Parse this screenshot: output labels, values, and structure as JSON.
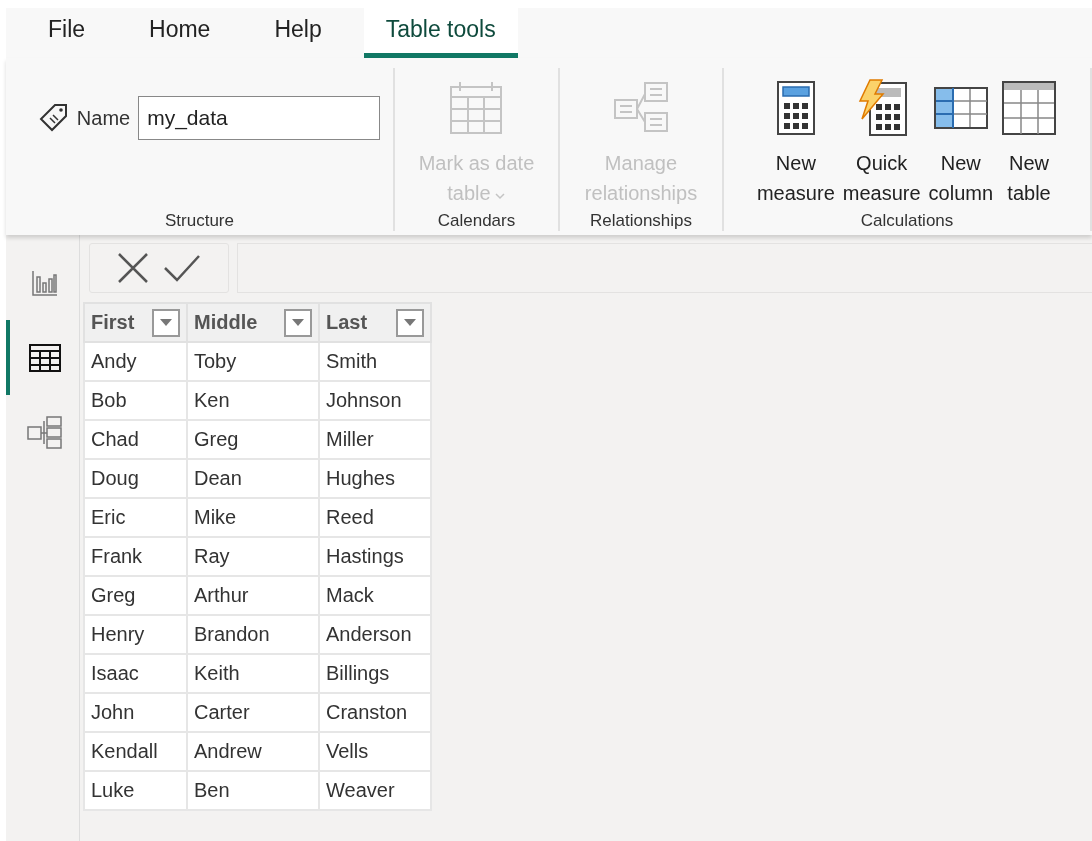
{
  "tabs": [
    {
      "label": "File",
      "selected": false
    },
    {
      "label": "Home",
      "selected": false
    },
    {
      "label": "Help",
      "selected": false
    },
    {
      "label": "Table tools",
      "selected": true
    }
  ],
  "ribbon": {
    "groups": [
      {
        "title": "Structure",
        "name_field": {
          "label": "Name",
          "value": "my_data"
        }
      },
      {
        "title": "Calendars",
        "buttons": [
          {
            "kind": "calendar",
            "lines": [
              "Mark as date",
              "table"
            ],
            "dropdown": true,
            "disabled": true
          }
        ]
      },
      {
        "title": "Relationships",
        "buttons": [
          {
            "kind": "relationships",
            "lines": [
              "Manage",
              "relationships"
            ],
            "dropdown": false,
            "disabled": true
          }
        ]
      },
      {
        "title": "Calculations",
        "buttons": [
          {
            "kind": "measure",
            "lines": [
              "New",
              "measure"
            ],
            "dropdown": false,
            "disabled": false
          },
          {
            "kind": "quick",
            "lines": [
              "Quick",
              "measure"
            ],
            "dropdown": false,
            "disabled": false
          },
          {
            "kind": "column",
            "lines": [
              "New",
              "column"
            ],
            "dropdown": false,
            "disabled": false
          },
          {
            "kind": "table",
            "lines": [
              "New",
              "table"
            ],
            "dropdown": false,
            "disabled": false
          }
        ]
      }
    ]
  },
  "nav": [
    {
      "kind": "report",
      "selected": false
    },
    {
      "kind": "data",
      "selected": true
    },
    {
      "kind": "model",
      "selected": false
    }
  ],
  "table": {
    "columns": [
      "First",
      "Middle",
      "Last"
    ],
    "rows": [
      [
        "Andy",
        "Toby",
        "Smith"
      ],
      [
        "Bob",
        "Ken",
        "Johnson"
      ],
      [
        "Chad",
        "Greg",
        "Miller"
      ],
      [
        "Doug",
        "Dean",
        "Hughes"
      ],
      [
        "Eric",
        "Mike",
        "Reed"
      ],
      [
        "Frank",
        "Ray",
        "Hastings"
      ],
      [
        "Greg",
        "Arthur",
        "Mack"
      ],
      [
        "Henry",
        "Brandon",
        "Anderson"
      ],
      [
        "Isaac",
        "Keith",
        "Billings"
      ],
      [
        "John",
        "Carter",
        "Cranston"
      ],
      [
        "Kendall",
        "Andrew",
        "Vells"
      ],
      [
        "Luke",
        "Ben",
        "Weaver"
      ]
    ]
  }
}
